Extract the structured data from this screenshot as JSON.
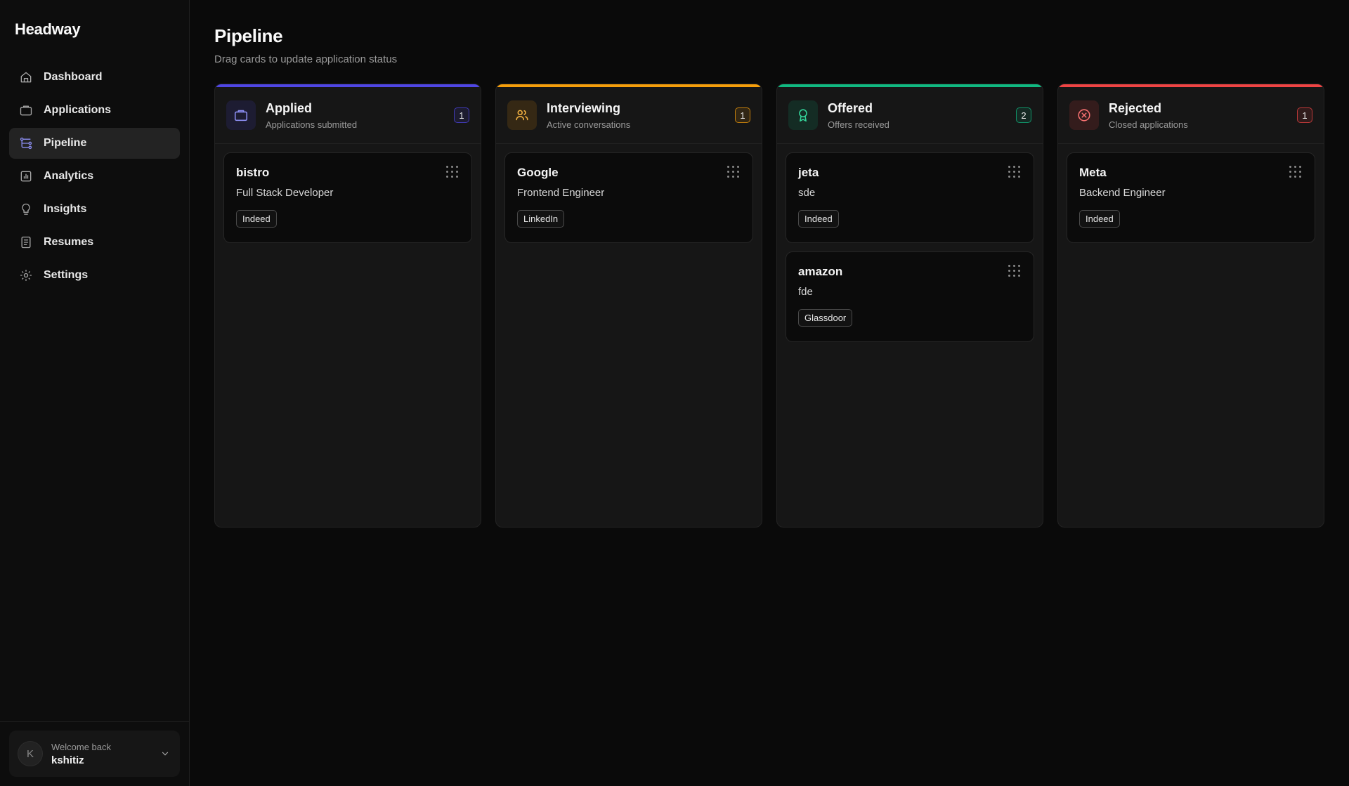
{
  "app": {
    "brand": "Headway"
  },
  "sidebar": {
    "items": [
      {
        "label": "Dashboard",
        "icon": "home-icon",
        "active": false
      },
      {
        "label": "Applications",
        "icon": "briefcase-icon",
        "active": false
      },
      {
        "label": "Pipeline",
        "icon": "pipeline-icon",
        "active": true
      },
      {
        "label": "Analytics",
        "icon": "bar-chart-icon",
        "active": false
      },
      {
        "label": "Insights",
        "icon": "lightbulb-icon",
        "active": false
      },
      {
        "label": "Resumes",
        "icon": "document-icon",
        "active": false
      },
      {
        "label": "Settings",
        "icon": "gear-icon",
        "active": false
      }
    ],
    "user": {
      "avatar_initial": "K",
      "welcome": "Welcome back",
      "name": "kshitiz"
    }
  },
  "page": {
    "title": "Pipeline",
    "subtitle": "Drag cards to update application status"
  },
  "columns": [
    {
      "title": "Applied",
      "subtitle": "Applications submitted",
      "count": "1",
      "accent": "#4f46e5",
      "icon": "briefcase-icon",
      "cards": [
        {
          "company": "bistro",
          "role": "Full Stack Developer",
          "source": "Indeed"
        }
      ]
    },
    {
      "title": "Interviewing",
      "subtitle": "Active conversations",
      "count": "1",
      "accent": "#f59e0b",
      "icon": "users-icon",
      "cards": [
        {
          "company": "Google",
          "role": "Frontend Engineer",
          "source": "LinkedIn"
        }
      ]
    },
    {
      "title": "Offered",
      "subtitle": "Offers received",
      "count": "2",
      "accent": "#10b981",
      "icon": "award-icon",
      "cards": [
        {
          "company": "jeta",
          "role": "sde",
          "source": "Indeed"
        },
        {
          "company": "amazon",
          "role": "fde",
          "source": "Glassdoor"
        }
      ]
    },
    {
      "title": "Rejected",
      "subtitle": "Closed applications",
      "count": "1",
      "accent": "#ef4444",
      "icon": "x-circle-icon",
      "cards": [
        {
          "company": "Meta",
          "role": "Backend Engineer",
          "source": "Indeed"
        }
      ]
    }
  ]
}
